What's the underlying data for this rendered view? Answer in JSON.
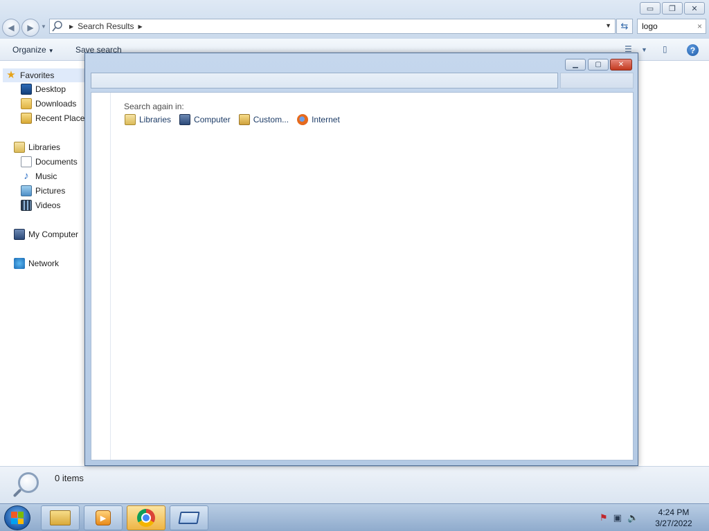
{
  "explorer": {
    "window_controls": {
      "minimize": "▭",
      "restore": "❐",
      "close": "✕"
    },
    "address": {
      "path_label": "Search Results"
    },
    "search": {
      "value": "logo",
      "clear": "×"
    },
    "toolbar": {
      "organize": "Organize",
      "save_search": "Save search"
    }
  },
  "nav": {
    "favorites": "Favorites",
    "desktop": "Desktop",
    "downloads": "Downloads",
    "recent_places": "Recent Places",
    "libraries": "Libraries",
    "documents": "Documents",
    "music": "Music",
    "pictures": "Pictures",
    "videos": "Videos",
    "my_computer": "My Computer",
    "network": "Network"
  },
  "dialog": {
    "controls": {
      "minimize": "▁",
      "maximize": "▢",
      "close": "✕"
    },
    "search_again_label": "Search again in:",
    "locations": {
      "libraries": "Libraries",
      "computer": "Computer",
      "custom": "Custom...",
      "internet": "Internet"
    }
  },
  "status": {
    "items": "0 items"
  },
  "taskbar": {
    "time": "4:24 PM",
    "date": "3/27/2022",
    "apps": [
      "windows-explorer",
      "media-player",
      "google-chrome",
      "app-window"
    ]
  },
  "colors": {
    "accent": "#1d5aa8",
    "close": "#c2391f"
  }
}
